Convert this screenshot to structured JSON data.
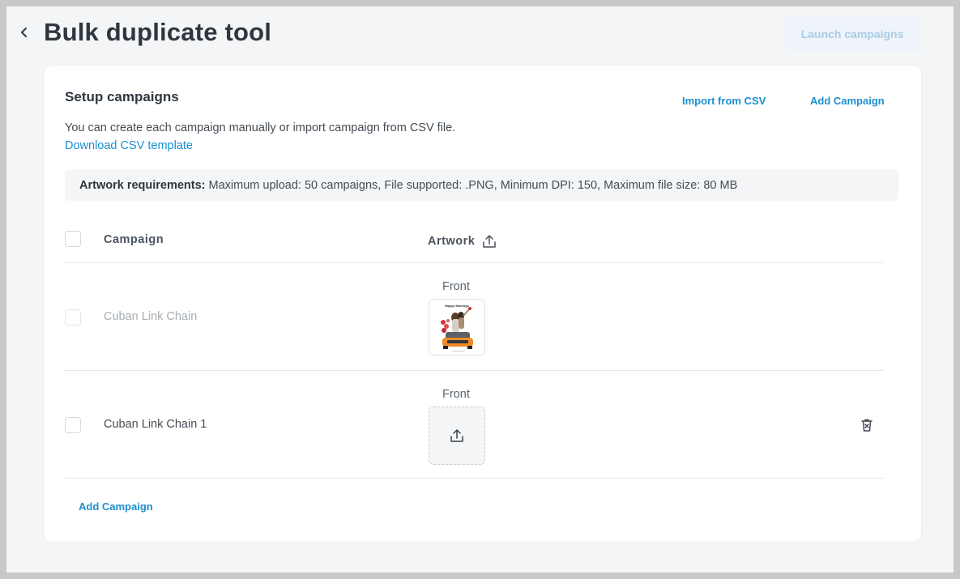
{
  "header": {
    "title": "Bulk duplicate tool",
    "launch_label": "Launch campaigns",
    "back_icon": "chevron-left-icon"
  },
  "setup": {
    "title": "Setup campaigns",
    "import_csv_label": "Import from CSV",
    "add_campaign_label": "Add Campaign",
    "description": "You can create each campaign manually or import campaign from CSV file.",
    "download_label": "Download CSV template",
    "requirements_label": "Artwork requirements:",
    "requirements_text": "Maximum upload: 50 campaigns, File supported: .PNG, Minimum DPI: 150, Maximum file size: 80 MB"
  },
  "table": {
    "columns": [
      "Campaign",
      "Artwork"
    ],
    "artwork_upload_icon": "upload-icon",
    "rows": [
      {
        "name": "Cuban Link Chain",
        "artwork_side": "Front",
        "has_artwork": true,
        "artwork_caption": "Happy Marriage",
        "enabled": false
      },
      {
        "name": "Cuban Link Chain 1",
        "artwork_side": "Front",
        "has_artwork": false,
        "enabled": true,
        "delete_icon": "trash-icon"
      }
    ]
  },
  "footer": {
    "add_campaign_label": "Add Campaign"
  },
  "colors": {
    "accent": "#1b8fd1",
    "launch_disabled_bg": "#eef4f9",
    "launch_disabled_text": "#a8cbe6",
    "page_bg": "#f4f5f6",
    "card_bg": "#ffffff",
    "disabled_text": "#a7adb3"
  }
}
